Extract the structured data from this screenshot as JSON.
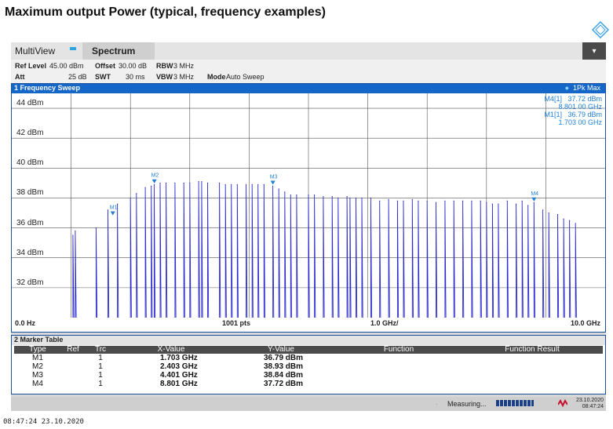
{
  "page": {
    "title": "Maximum output Power (typical, frequency examples)",
    "footer_timestamp": "08:47:24  23.10.2020",
    "logo_icon": "rohde-schwarz-diamond-icon"
  },
  "tabs": {
    "multiview": "MultiView",
    "spectrum": "Spectrum",
    "menu_icon": "dropdown-arrow-icon",
    "menu_glyph": "▾"
  },
  "settings": {
    "ref_level_label": "Ref Level",
    "ref_level_value": "45.00 dBm",
    "offset_label": "Offset",
    "offset_value": "30.00 dB",
    "rbw_label": "RBW",
    "rbw_value": "3 MHz",
    "att_label": "Att",
    "att_value": "25 dB",
    "swt_label": "SWT",
    "swt_value": "30 ms",
    "vbw_label": "VBW",
    "vbw_value": "3 MHz",
    "mode_label": "Mode",
    "mode_value": "Auto Sweep"
  },
  "window": {
    "title": "1 Frequency Sweep",
    "trace_label": "1Pk Max",
    "trace_marker": "●",
    "marker_readouts": [
      {
        "name": "M4[1]",
        "level": "37.72 dBm",
        "freq": "8.801 00 GHz"
      },
      {
        "name": "M1[1]",
        "level": "36.79 dBm",
        "freq": "1.703 00 GHz"
      }
    ],
    "x_start": "0.0 Hz",
    "x_points": "1001 pts",
    "x_div": "1.0 GHz/",
    "x_stop": "10.0 GHz"
  },
  "chart_data": {
    "type": "line",
    "xlabel": "",
    "ylabel": "",
    "xlim": [
      0,
      10
    ],
    "ylim": [
      30,
      45
    ],
    "y_ticks": [
      "44 dBm",
      "42 dBm",
      "40 dBm",
      "38 dBm",
      "36 dBm",
      "34 dBm",
      "32 dBm"
    ],
    "y_tick_values": [
      44,
      42,
      40,
      38,
      36,
      34,
      32
    ],
    "grid": true,
    "trace_color": "#2c2ccf",
    "marker_color": "#1f7fd3",
    "series": [
      {
        "x": [
          1.03,
          1.07,
          1.42,
          1.62,
          1.78,
          2.0,
          2.1,
          2.25,
          2.35,
          2.4,
          2.5,
          2.6,
          2.75,
          2.9,
          3.0,
          3.15,
          3.2,
          3.3,
          3.5,
          3.6,
          3.7,
          3.8,
          3.95,
          4.05,
          4.15,
          4.25,
          4.4,
          4.5,
          4.6,
          4.7,
          4.8,
          5.0,
          5.1,
          5.25,
          5.4,
          5.5,
          5.65,
          5.7,
          5.8,
          5.9,
          6.05,
          6.2,
          6.35,
          6.5,
          6.6,
          6.75,
          6.85,
          7.0,
          7.15,
          7.3,
          7.45,
          7.6,
          7.75,
          7.9,
          8.0,
          8.1,
          8.2,
          8.35,
          8.5,
          8.6,
          8.7,
          8.8,
          8.95,
          9.05,
          9.2,
          9.3,
          9.4,
          9.5
        ],
        "y": [
          35.5,
          35.8,
          36.0,
          37.2,
          37.6,
          38.0,
          38.3,
          38.7,
          38.8,
          38.9,
          39.0,
          39.0,
          39.0,
          39.0,
          39.0,
          39.1,
          39.1,
          39.0,
          39.0,
          38.9,
          38.9,
          38.9,
          38.9,
          38.9,
          38.9,
          38.9,
          38.8,
          38.6,
          38.4,
          38.2,
          38.2,
          38.2,
          38.2,
          38.1,
          38.1,
          38.0,
          38.1,
          38.0,
          38.0,
          38.0,
          38.0,
          37.8,
          37.9,
          37.8,
          37.8,
          37.9,
          37.8,
          37.8,
          37.7,
          37.8,
          37.8,
          37.8,
          37.8,
          37.8,
          37.7,
          37.6,
          37.6,
          37.8,
          37.6,
          37.8,
          37.5,
          37.7,
          37.2,
          37.0,
          36.9,
          36.6,
          36.5,
          36.3
        ]
      }
    ],
    "markers": [
      {
        "label": "M1",
        "x": 1.703,
        "y": 36.79
      },
      {
        "label": "M2",
        "x": 2.403,
        "y": 38.93
      },
      {
        "label": "M3",
        "x": 4.401,
        "y": 38.84
      },
      {
        "label": "M4",
        "x": 8.801,
        "y": 37.72
      }
    ]
  },
  "marker_table": {
    "title": "2 Marker Table",
    "headers": [
      "Type",
      "Ref",
      "Trc",
      "X-Value",
      "Y-Value",
      "Function",
      "Function Result"
    ],
    "rows": [
      {
        "type": "M1",
        "ref": "",
        "trc": "1",
        "x": "1.703 GHz",
        "y": "36.79 dBm",
        "function": "",
        "result": ""
      },
      {
        "type": "M2",
        "ref": "",
        "trc": "1",
        "x": "2.403 GHz",
        "y": "38.93 dBm",
        "function": "",
        "result": ""
      },
      {
        "type": "M3",
        "ref": "",
        "trc": "1",
        "x": "4.401 GHz",
        "y": "38.84 dBm",
        "function": "",
        "result": ""
      },
      {
        "type": "M4",
        "ref": "",
        "trc": "1",
        "x": "8.801 GHz",
        "y": "37.72 dBm",
        "function": "",
        "result": ""
      }
    ]
  },
  "status": {
    "measuring": "Measuring...",
    "progress_percent": 100,
    "date": "23.10.2020",
    "time": "08:47:24"
  }
}
